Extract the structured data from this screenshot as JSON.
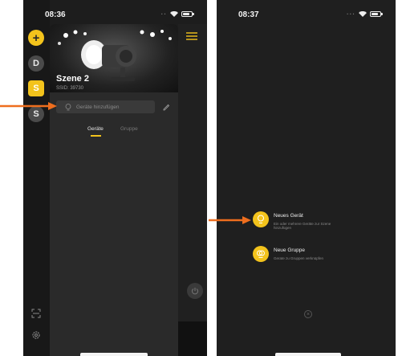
{
  "left_screen": {
    "time": "08:36",
    "rail": {
      "add_label": "+",
      "items": [
        "D",
        "S",
        "S"
      ]
    },
    "scene": {
      "title": "Szene 2",
      "ssid": "SSID: 39730"
    },
    "add_devices_placeholder": "Geräte hinzufügen",
    "tabs": [
      "Geräte",
      "Gruppe"
    ]
  },
  "right_screen": {
    "time": "08:37",
    "menu": [
      {
        "title": "Neues Gerät",
        "subtitle": "Ein oder mehrere Geräte zur Szene hinzufügen"
      },
      {
        "title": "Neue Gruppe",
        "subtitle": "Gerate zu Gruppen verknüpfen"
      }
    ],
    "close_label": "×"
  },
  "colors": {
    "accent": "#f3c31c",
    "arrow": "#ee6e1e",
    "background_dark": "#1d1d1d"
  },
  "icons": [
    "plus-icon",
    "bulb-icon",
    "edit-icon",
    "scan-icon",
    "settings-icon",
    "menu-icon",
    "power-icon",
    "wifi-icon",
    "battery-icon",
    "close-icon"
  ]
}
